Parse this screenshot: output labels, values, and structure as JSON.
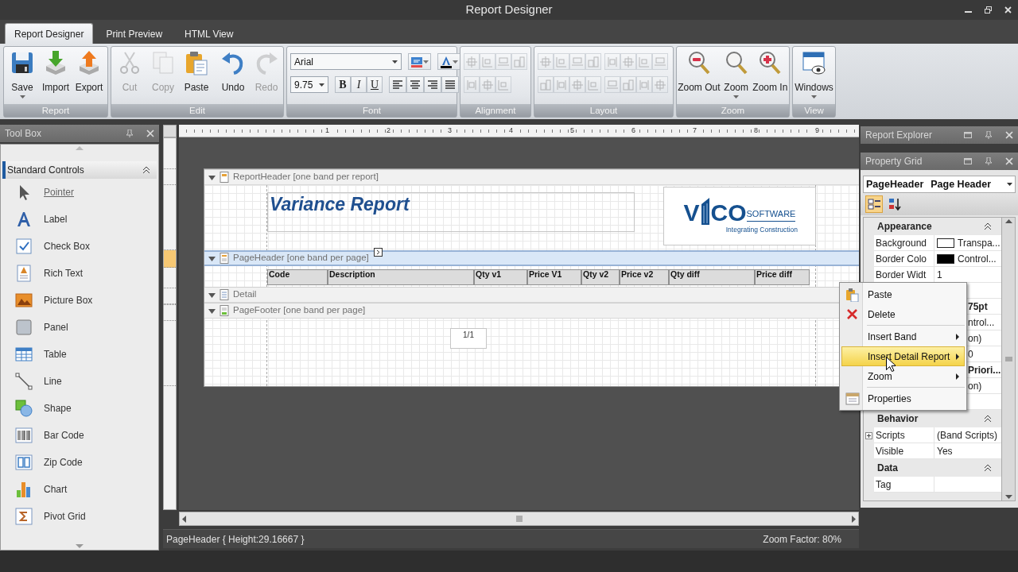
{
  "window": {
    "title": "Report Designer"
  },
  "ribbon_tabs": [
    {
      "label": "Report Designer",
      "selected": true
    },
    {
      "label": "Print Preview",
      "selected": false
    },
    {
      "label": "HTML View",
      "selected": false
    }
  ],
  "ribbon_groups": [
    {
      "label": "Report",
      "kind": "buttons",
      "buttons": [
        {
          "label": "Save",
          "disabled": false,
          "dropdown": true
        },
        {
          "label": "Import",
          "disabled": false,
          "dropdown": false
        },
        {
          "label": "Export",
          "disabled": false,
          "dropdown": false
        }
      ]
    },
    {
      "label": "Edit",
      "kind": "buttons",
      "buttons": [
        {
          "label": "Cut",
          "disabled": true,
          "dropdown": false
        },
        {
          "label": "Copy",
          "disabled": true,
          "dropdown": false
        },
        {
          "label": "Paste",
          "disabled": false,
          "dropdown": false
        },
        {
          "label": "Undo",
          "disabled": false,
          "dropdown": false,
          "separator": true
        },
        {
          "label": "Redo",
          "disabled": true,
          "dropdown": false
        }
      ]
    },
    {
      "label": "Font",
      "kind": "font",
      "font_name": "Arial",
      "font_size": "9.75",
      "styles": [
        "B",
        "I",
        "U"
      ]
    },
    {
      "label": "Alignment",
      "kind": "alignment",
      "disabled": true
    },
    {
      "label": "Layout",
      "kind": "layout",
      "disabled": true
    },
    {
      "label": "Zoom",
      "kind": "buttons",
      "buttons": [
        {
          "label": "Zoom Out",
          "disabled": false,
          "dropdown": false
        },
        {
          "label": "Zoom",
          "disabled": false,
          "dropdown": true
        },
        {
          "label": "Zoom In",
          "disabled": false,
          "dropdown": false
        }
      ]
    },
    {
      "label": "View",
      "kind": "buttons",
      "buttons": [
        {
          "label": "Windows",
          "disabled": false,
          "dropdown": true
        }
      ]
    }
  ],
  "toolbox": {
    "title": "Tool Box",
    "category": {
      "label": "Standard Controls",
      "expanded": true
    },
    "items": [
      {
        "label": "Pointer",
        "selected": true
      },
      {
        "label": "Label",
        "selected": false
      },
      {
        "label": "Check Box",
        "selected": false
      },
      {
        "label": "Rich Text",
        "selected": false
      },
      {
        "label": "Picture Box",
        "selected": false
      },
      {
        "label": "Panel",
        "selected": false
      },
      {
        "label": "Table",
        "selected": false
      },
      {
        "label": "Line",
        "selected": false
      },
      {
        "label": "Shape",
        "selected": false
      },
      {
        "label": "Bar Code",
        "selected": false
      },
      {
        "label": "Zip Code",
        "selected": false
      },
      {
        "label": "Chart",
        "selected": false
      },
      {
        "label": "Pivot Grid",
        "selected": false
      }
    ]
  },
  "designer": {
    "ruler_labels": [
      "1",
      "2",
      "3",
      "4",
      "5",
      "6",
      "7",
      "8",
      "9"
    ],
    "bands": [
      {
        "kind": "report_header",
        "label": "ReportHeader [one band per report]",
        "selected": false,
        "expanded": true,
        "title": "Variance Report",
        "logo": {
          "left": "V",
          "right": "CO",
          "word": "SOFTWARE",
          "tagline": "Integrating Construction"
        }
      },
      {
        "kind": "page_header",
        "label": "PageHeader [one band per page]",
        "selected": true,
        "expanded": true,
        "columns": [
          "Code",
          "Description",
          "Qty v1",
          "Price V1",
          "Qty v2",
          "Price v2",
          "Qty diff",
          "Price diff"
        ]
      },
      {
        "kind": "detail",
        "label": "Detail",
        "selected": false,
        "expanded": true
      },
      {
        "kind": "page_footer",
        "label": "PageFooter [one band per page]",
        "selected": false,
        "expanded": true,
        "page_number": "1/1"
      }
    ]
  },
  "status_bar": {
    "selection": "PageHeader { Height:29.16667 }",
    "zoom": "Zoom Factor: 80%"
  },
  "report_explorer": {
    "title": "Report Explorer"
  },
  "property_grid": {
    "title": "Property Grid",
    "object_name": "PageHeader",
    "object_type": "Page Header",
    "view_buttons": [
      {
        "selected": true
      },
      {
        "selected": false
      }
    ],
    "categories": [
      {
        "label": "Appearance",
        "expanded": true,
        "rows": [
          {
            "kind": "property",
            "name": "Background",
            "value": "Transpa...",
            "color": "#ffffff"
          },
          {
            "kind": "property",
            "name": "Border Colo",
            "value": "Control...",
            "color": "#000000"
          },
          {
            "kind": "property",
            "name": "Border Widt",
            "value": "1"
          },
          {
            "kind": "covered"
          },
          {
            "kind": "covered",
            "value": "75pt",
            "bold": true
          },
          {
            "kind": "covered",
            "value": "ntrol..."
          },
          {
            "kind": "covered",
            "value": "on)"
          },
          {
            "kind": "covered",
            "value": "0"
          },
          {
            "kind": "covered",
            "value": "Priori...",
            "bold": true
          },
          {
            "kind": "covered",
            "value": "on)"
          },
          {
            "kind": "covered"
          }
        ]
      },
      {
        "label": "Behavior",
        "expanded": true,
        "rows": [
          {
            "kind": "property",
            "name": "Scripts",
            "value": "(Band Scripts)",
            "expandable": true
          },
          {
            "kind": "property",
            "name": "Visible",
            "value": "Yes"
          }
        ]
      },
      {
        "label": "Data",
        "expanded": true,
        "rows": [
          {
            "kind": "property",
            "name": "Tag"
          }
        ]
      }
    ]
  },
  "context_menu": {
    "items": [
      {
        "kind": "command",
        "label": "Paste",
        "selected": false,
        "submenu": false
      },
      {
        "kind": "command",
        "label": "Delete",
        "selected": false,
        "submenu": false
      },
      {
        "kind": "separator"
      },
      {
        "kind": "command",
        "label": "Insert Band",
        "selected": false,
        "submenu": true
      },
      {
        "kind": "command",
        "label": "Insert Detail Report",
        "selected": true,
        "submenu": true
      },
      {
        "kind": "command",
        "label": "Zoom",
        "selected": false,
        "submenu": true
      },
      {
        "kind": "separator"
      },
      {
        "kind": "command",
        "label": "Properties",
        "selected": false,
        "submenu": false
      }
    ]
  }
}
